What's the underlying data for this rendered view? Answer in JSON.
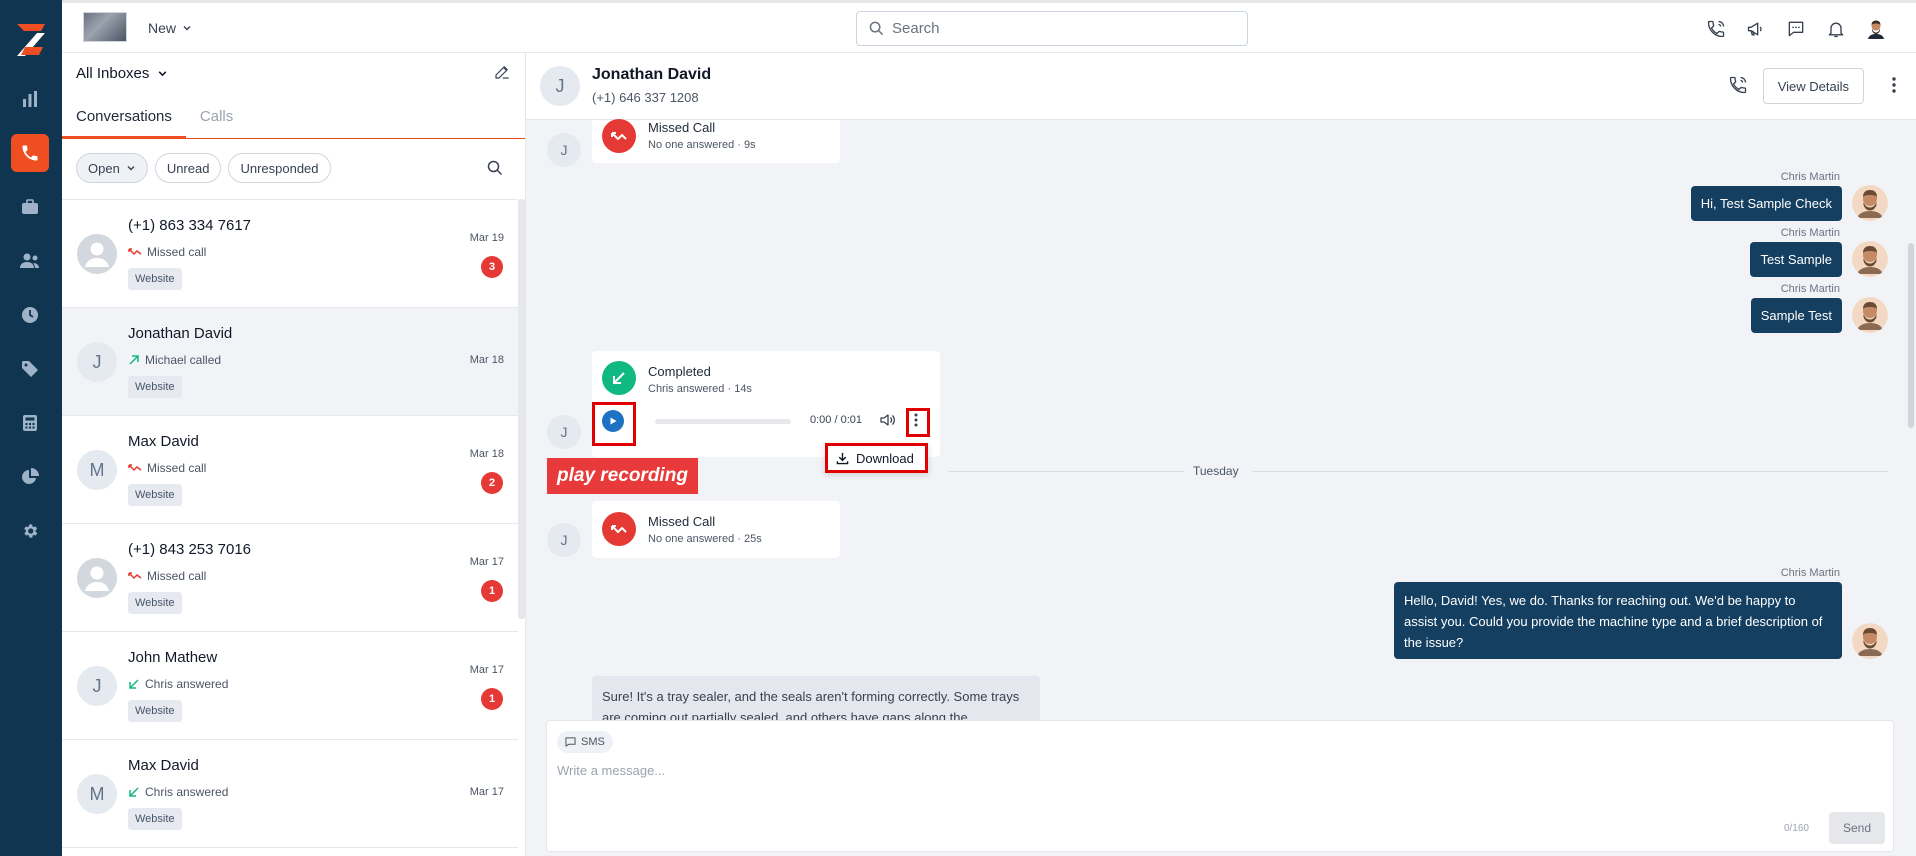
{
  "topbar": {
    "new_label": "New",
    "search_placeholder": "Search"
  },
  "list": {
    "inbox_label": "All Inboxes",
    "tabs": [
      {
        "label": "Conversations"
      },
      {
        "label": "Calls"
      }
    ],
    "filters": [
      {
        "label": "Open"
      },
      {
        "label": "Unread"
      },
      {
        "label": "Unresponded"
      }
    ],
    "rows": [
      {
        "avatar": "",
        "name": "(+1) 863 334 7617",
        "status": "Missed call",
        "status_type": "missed",
        "tag": "Website",
        "date": "Mar 19",
        "badge": "3"
      },
      {
        "avatar": "J",
        "name": "Jonathan David",
        "status": "Michael called",
        "status_type": "outgoing",
        "tag": "Website",
        "date": "Mar 18",
        "badge": ""
      },
      {
        "avatar": "M",
        "name": "Max David",
        "status": "Missed call",
        "status_type": "missed",
        "tag": "Website",
        "date": "Mar 18",
        "badge": "2"
      },
      {
        "avatar": "",
        "name": "(+1) 843 253 7016",
        "status": "Missed call",
        "status_type": "missed",
        "tag": "Website",
        "date": "Mar 17",
        "badge": "1"
      },
      {
        "avatar": "J",
        "name": "John Mathew",
        "status": "Chris answered",
        "status_type": "incoming",
        "tag": "Website",
        "date": "Mar 17",
        "badge": "1"
      },
      {
        "avatar": "M",
        "name": "Max David",
        "status": "Chris answered",
        "status_type": "incoming",
        "tag": "Website",
        "date": "Mar 17",
        "badge": ""
      }
    ]
  },
  "chat": {
    "contact_initial": "J",
    "contact_name": "Jonathan David",
    "contact_phone": "(+1) 646 337 1208",
    "view_details_label": "View Details",
    "missed_call_1": {
      "title": "Missed Call",
      "detail": "No one answered · 9s"
    },
    "outgoing": [
      {
        "author": "Chris Martin",
        "text": "Hi, Test Sample Check"
      },
      {
        "author": "Chris Martin",
        "text": "Test Sample"
      },
      {
        "author": "Chris Martin",
        "text": "Sample Test"
      }
    ],
    "completed_call": {
      "title": "Completed",
      "detail": "Chris answered · 14s",
      "time": "0:00 / 0:01"
    },
    "annotation_label": "play recording",
    "download_label": "Download",
    "day_divider": "Tuesday",
    "missed_call_2": {
      "title": "Missed Call",
      "detail": "No one answered · 25s"
    },
    "long_reply": {
      "author": "Chris Martin",
      "text": "Hello, David! Yes, we do. Thanks for reaching out. We'd be happy to assist you. Could you provide the machine type and a brief description of the issue?"
    },
    "incoming_reply": "Sure! It's a tray sealer, and the seals aren't forming correctly. Some trays are coming out partially sealed, and others have gaps along the"
  },
  "composer": {
    "channel_label": "SMS",
    "placeholder": "Write a message...",
    "counter": "0/160",
    "send_label": "Send"
  },
  "colors": {
    "rail": "#0f3550",
    "accent": "#ef4e22",
    "outgoing_bubble": "#143f61",
    "missed": "#e53935",
    "answered": "#10b981",
    "play": "#1d72c4",
    "highlight": "#e00000"
  }
}
